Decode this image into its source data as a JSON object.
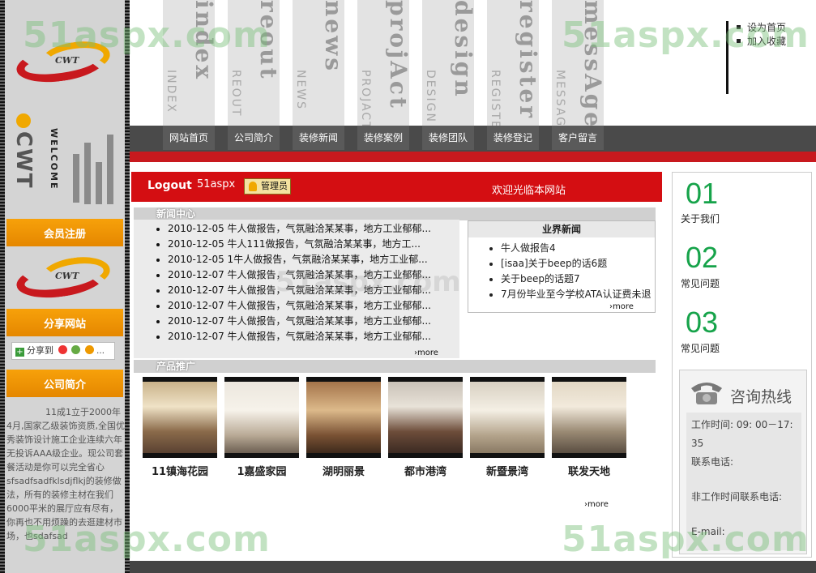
{
  "sidebar": {
    "logo_text": "CWT",
    "brand_vertical": "CWT",
    "welcome_vertical": "WELCOME",
    "btn_register": "会员注册",
    "btn_share": "分享网站",
    "share_label": "分享到",
    "btn_intro": "公司简介",
    "intro_text": "11成1立于2000年4月,国家乙级装饰资质,全国优秀装饰设计施工企业连续六年无投诉AAA级企业。现公司套餐活动是你可以完全省心sfsadfsadfklsdjflkj的装修做法，所有的装修主材在我们6000平米的展厅应有尽有，你再也不用烦躁的去逛建材市场，也sdafsad"
  },
  "top_nav_cols": [
    {
      "big": "index",
      "small": "INDEX"
    },
    {
      "big": "reout",
      "small": "REOUT"
    },
    {
      "big": "news",
      "small": "NEWS"
    },
    {
      "big": "projAct",
      "small": "PROJACT"
    },
    {
      "big": "design",
      "small": "DESIGN"
    },
    {
      "big": "register",
      "small": "REGISTER"
    },
    {
      "big": "messAge",
      "small": "MESSAGE"
    }
  ],
  "top_links": {
    "set_home": "设为首页",
    "favorite": "加入收藏"
  },
  "navbar": [
    "网站首页",
    "公司简介",
    "装修新闻",
    "装修案例",
    "装修团队",
    "装修登记",
    "客户留言"
  ],
  "user_bar": {
    "logout": "Logout",
    "username": "51aspx",
    "role": "管理员",
    "welcome": "欢迎光临本网站"
  },
  "news": {
    "title": "新闻中心",
    "items": [
      "2010-12-05 牛人做报告，气氛融洽某某事，地方工业郁郁...",
      "2010-12-05 牛人111做报告，气氛融洽某某事，地方工...",
      "2010-12-05 1牛人做报告，气氛融洽某某事，地方工业郁...",
      "2010-12-07 牛人做报告，气氛融洽某某事，地方工业郁郁...",
      "2010-12-07 牛人做报告，气氛融洽某某事，地方工业郁郁...",
      "2010-12-07 牛人做报告，气氛融洽某某事，地方工业郁郁...",
      "2010-12-07 牛人做报告，气氛融洽某某事，地方工业郁郁...",
      "2010-12-07 牛人做报告，气氛融洽某某事，地方工业郁郁..."
    ],
    "more": "›more"
  },
  "industry": {
    "title": "业界新闻",
    "items": [
      "牛人做报告4",
      "[isaa]关于beep的话6题",
      "关于beep的话题7",
      "7月份毕业至今学校ATA认证费未退"
    ],
    "more": "›more"
  },
  "products": {
    "title": "产品推广",
    "items": [
      "11镇海花园",
      "1嘉盛家园",
      "湖明丽景",
      "都市港湾",
      "新暨景湾",
      "联发天地"
    ],
    "more": "›more"
  },
  "right": {
    "links": [
      {
        "num": "01",
        "label": "关于我们"
      },
      {
        "num": "02",
        "label": "常见问题"
      },
      {
        "num": "03",
        "label": "常见问题"
      }
    ],
    "hotline_title": "咨询热线",
    "work_time": "工作时间: 09: 00－17: 35",
    "phone_label": "联系电话:",
    "offhours_label": "非工作时间联系电话:",
    "email_label": "E-mail:"
  },
  "watermark": "51aspx.com",
  "colors": {
    "accent_red": "#c8191e",
    "orange": "#f29a05",
    "green": "#16a34a",
    "nav_dark": "#4a4a4a"
  }
}
